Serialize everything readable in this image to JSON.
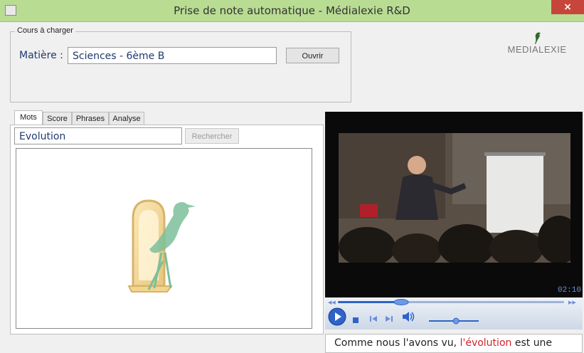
{
  "window": {
    "title": "Prise de note automatique - Médialexie R&D",
    "close_glyph": "×"
  },
  "course": {
    "group_label": "Cours à charger",
    "subject_label": "Matière :",
    "subject_value": "Sciences - 6ème B",
    "open_button": "Ouvrir"
  },
  "logo": {
    "text": "MEDIALEXIE",
    "accent_color": "#2d6b2f"
  },
  "tabs": [
    {
      "label": "Mots",
      "active": true
    },
    {
      "label": "Score",
      "active": false
    },
    {
      "label": "Phrases",
      "active": false
    },
    {
      "label": "Analyse",
      "active": false
    }
  ],
  "search": {
    "value": "Evolution",
    "button": "Rechercher"
  },
  "player": {
    "time": "02:10",
    "progress_fraction": 0.28,
    "volume_fraction": 0.55,
    "controls": [
      "play-icon",
      "stop-icon",
      "previous-icon",
      "next-icon",
      "volume-icon"
    ]
  },
  "caption": {
    "before": "Comme nous l'avons vu, ",
    "highlight": "l'évolution",
    "after": " est une",
    "highlight_color": "#d2232a"
  }
}
